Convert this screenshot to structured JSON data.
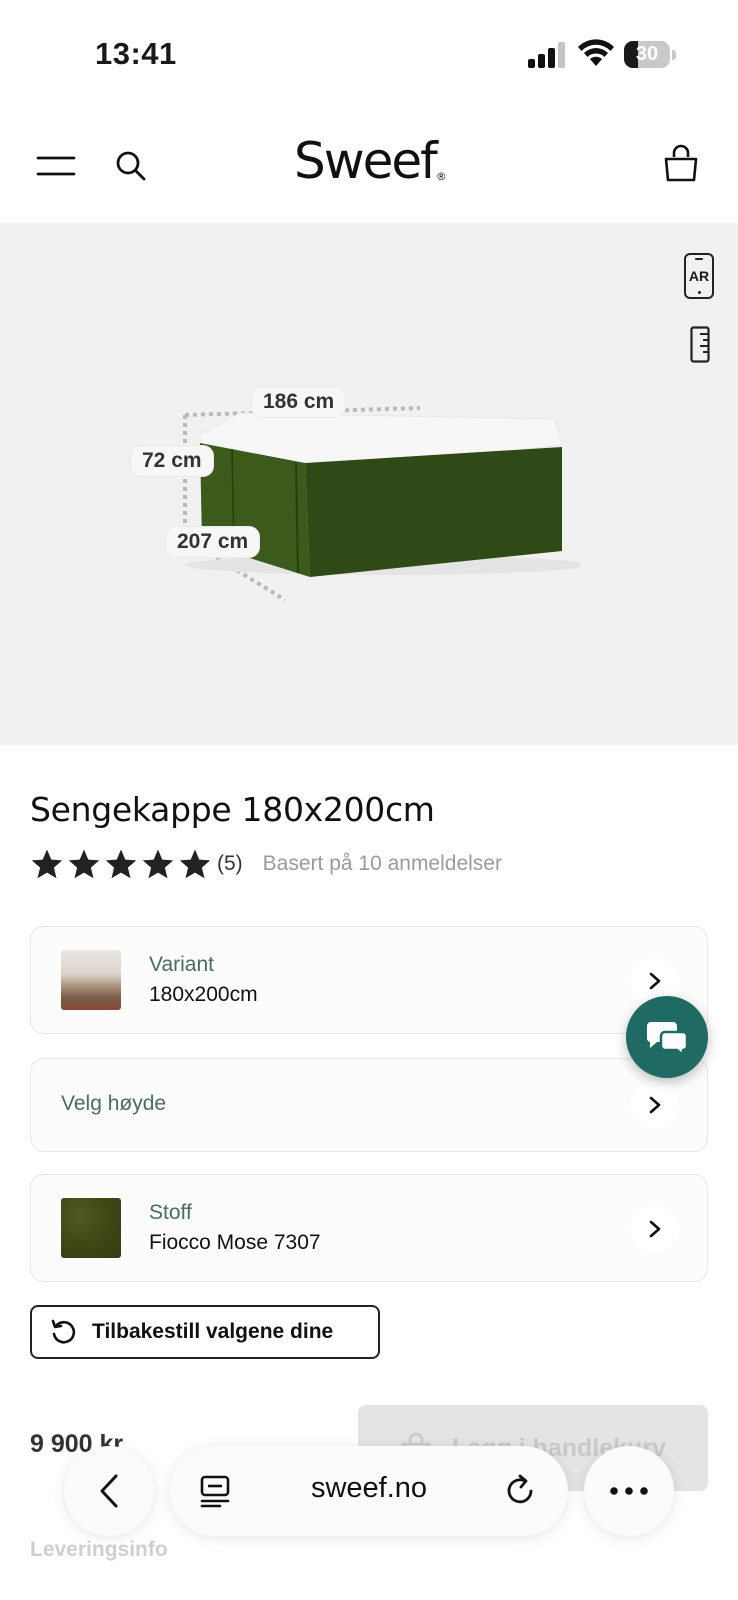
{
  "status_bar": {
    "time": "13:41",
    "battery": "30",
    "battery_level": 0.3
  },
  "header": {
    "logo": "Sweef",
    "logo_mark": "®"
  },
  "hero": {
    "ar_label": "AR",
    "dimensions": {
      "width": "186 cm",
      "height": "72 cm",
      "depth": "207 cm"
    },
    "product_color": "#2f4a16"
  },
  "product": {
    "title": "Sengekappe 180x200cm",
    "rating": 5,
    "rating_count": "(5)",
    "rating_text": "Basert på 10 anmeldelser"
  },
  "options": {
    "variant": {
      "label": "Variant",
      "value": "180x200cm"
    },
    "height": {
      "label": "Velg høyde"
    },
    "fabric": {
      "label": "Stoff",
      "value": "Fiocco Mose 7307"
    }
  },
  "actions": {
    "reset_label": "Tilbakestill valgene dine",
    "price": "9 900 kr",
    "add_to_cart_label": "Legg i handlekurv",
    "delivery_info": "Leveringsinfo"
  },
  "browser": {
    "url": "sweef.no"
  },
  "colors": {
    "accent": "#1f6b63",
    "option_label": "#4a6b66"
  }
}
